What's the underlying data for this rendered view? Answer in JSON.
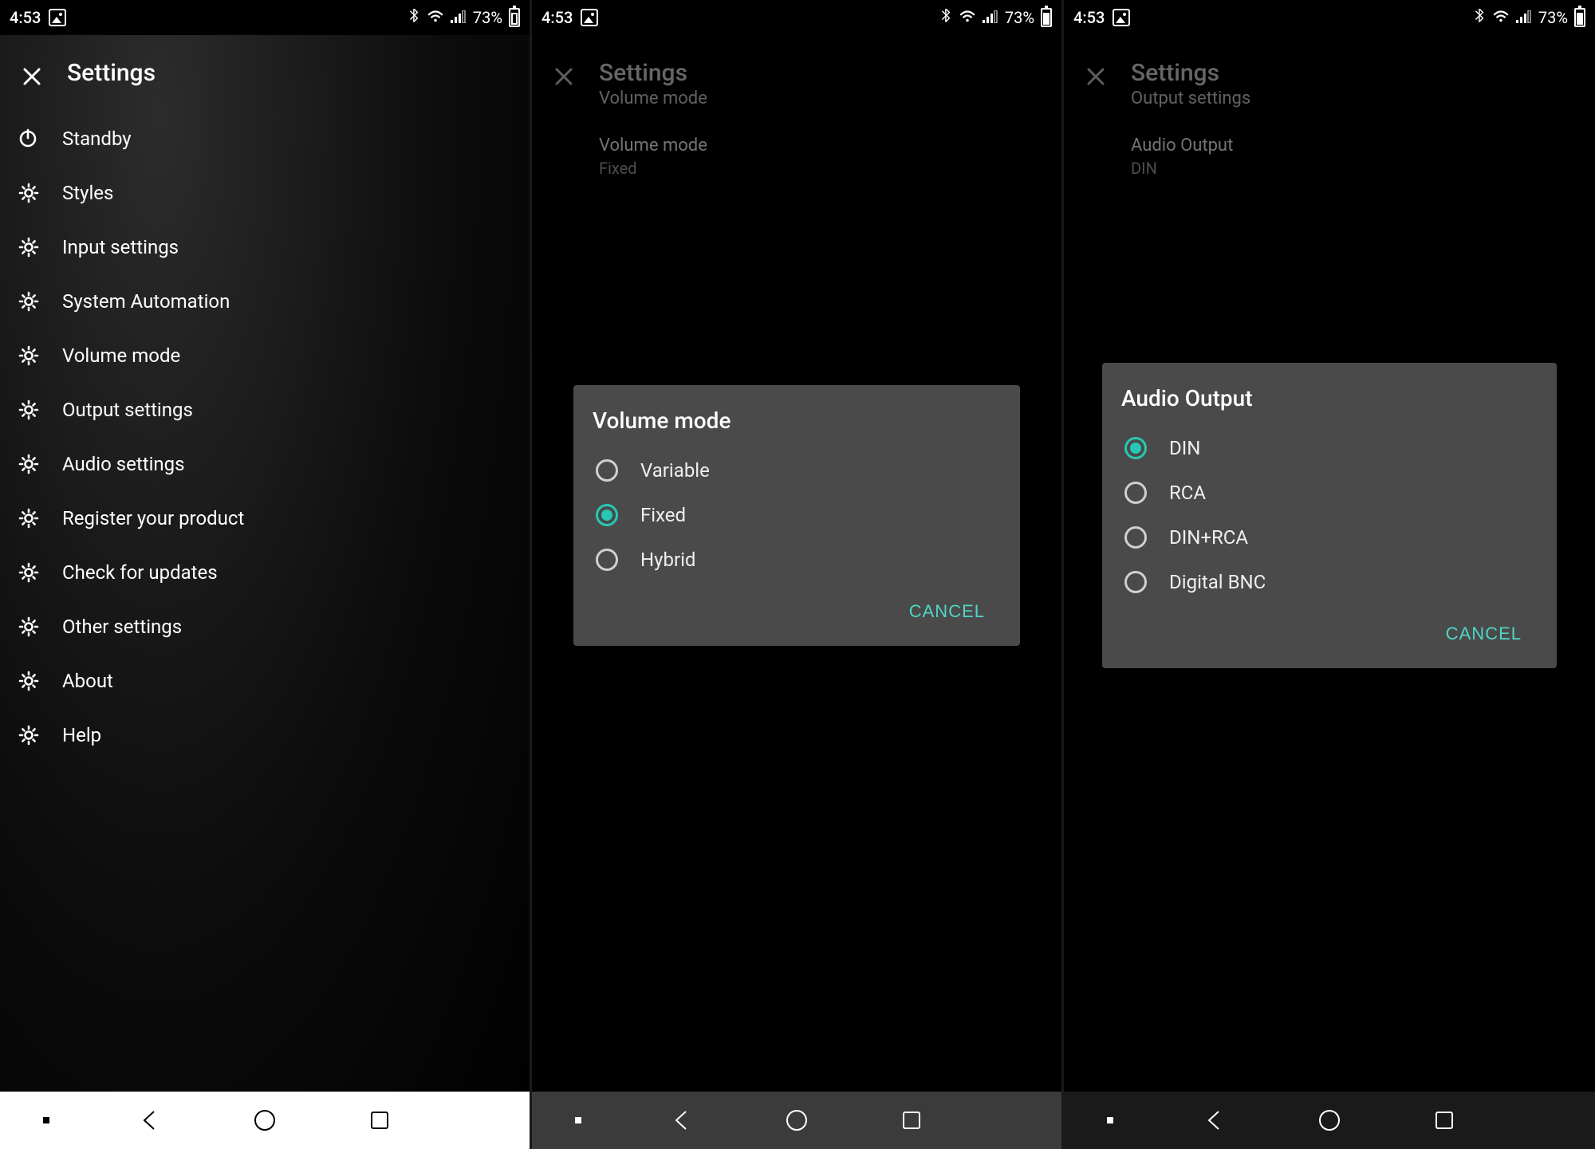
{
  "status": {
    "time": "4:53",
    "battery_pct": "73%"
  },
  "screen1": {
    "title": "Settings",
    "items": [
      {
        "icon": "power",
        "label": "Standby"
      },
      {
        "icon": "gear",
        "label": "Styles"
      },
      {
        "icon": "gear",
        "label": "Input settings"
      },
      {
        "icon": "gear",
        "label": "System Automation"
      },
      {
        "icon": "gear",
        "label": "Volume mode"
      },
      {
        "icon": "gear",
        "label": "Output settings"
      },
      {
        "icon": "gear",
        "label": "Audio settings"
      },
      {
        "icon": "gear",
        "label": "Register your product"
      },
      {
        "icon": "gear",
        "label": "Check for updates"
      },
      {
        "icon": "gear",
        "label": "Other settings"
      },
      {
        "icon": "gear",
        "label": "About"
      },
      {
        "icon": "gear",
        "label": "Help"
      }
    ]
  },
  "screen2": {
    "title": "Settings",
    "subtitle": "Volume mode",
    "pref_title": "Volume mode",
    "pref_value": "Fixed",
    "dialog": {
      "title": "Volume mode",
      "options": [
        "Variable",
        "Fixed",
        "Hybrid"
      ],
      "selected": "Fixed",
      "cancel": "CANCEL"
    }
  },
  "screen3": {
    "title": "Settings",
    "subtitle": "Output settings",
    "pref_title": "Audio Output",
    "pref_value": "DIN",
    "dialog": {
      "title": "Audio Output",
      "options": [
        "DIN",
        "RCA",
        "DIN+RCA",
        "Digital BNC"
      ],
      "selected": "DIN",
      "cancel": "CANCEL"
    }
  },
  "colors": {
    "accent": "#26c8b5",
    "dialog_bg": "#4a4a4a"
  }
}
